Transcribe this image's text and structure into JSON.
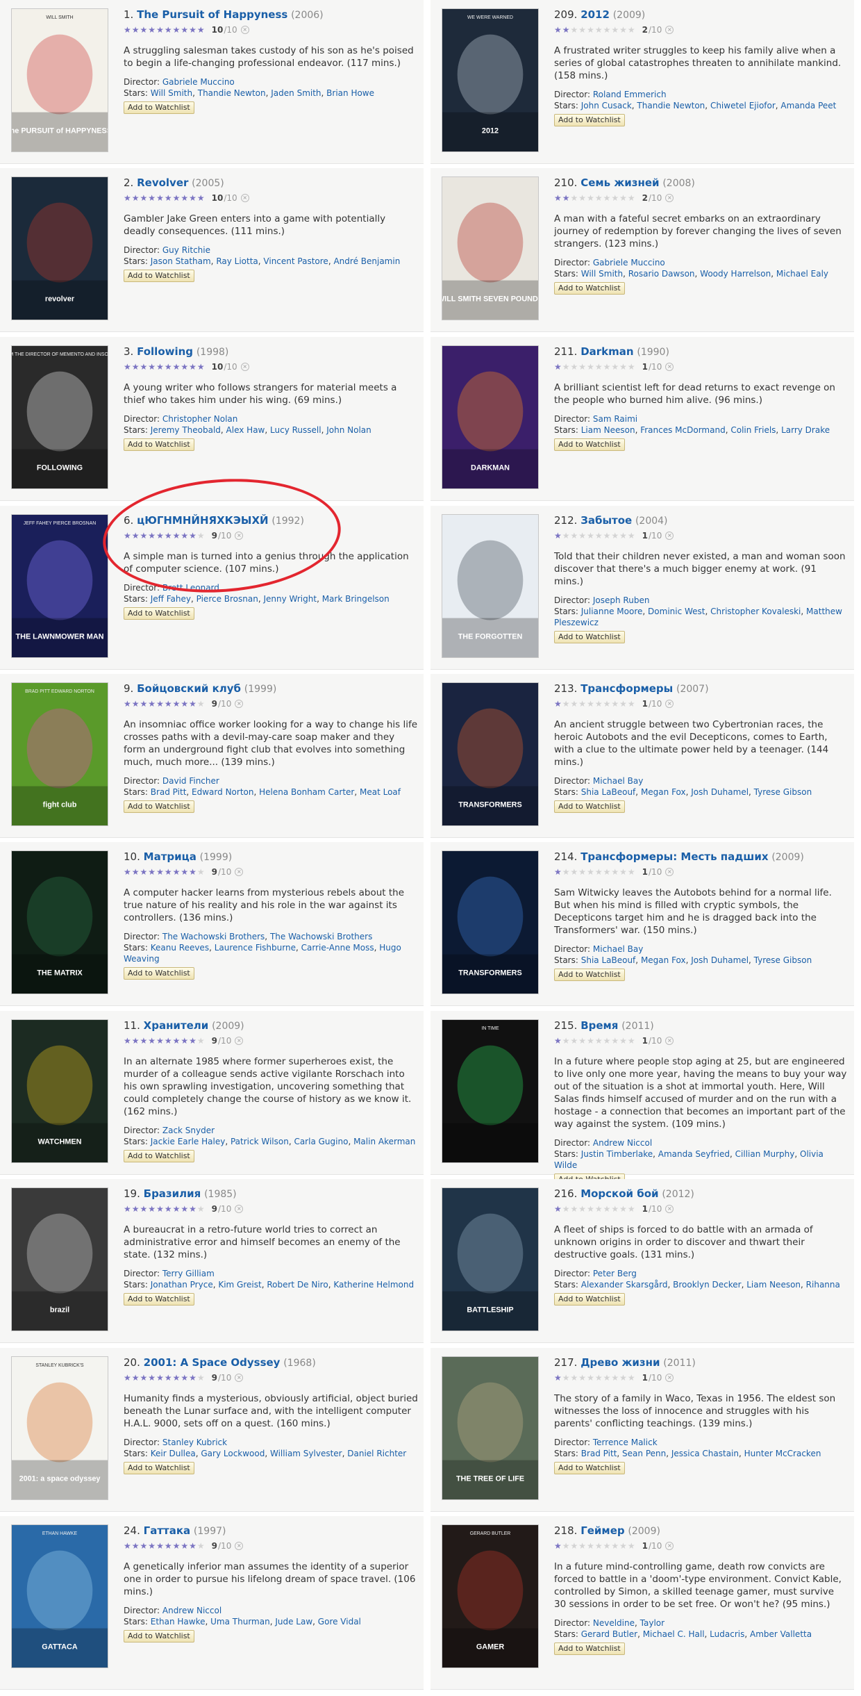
{
  "list_left": [
    {
      "rank": "1.",
      "title": "The Pursuit of Happyness",
      "year": "(2006)",
      "stars": 10,
      "score": "10",
      "outof": "/10",
      "outline": "A struggling salesman takes custody of his son as he's poised to begin a life-changing professional endeavor. (117 mins.)",
      "director": [
        "Gabriele Muccino"
      ],
      "cast": [
        "Will Smith",
        "Thandie Newton",
        "Jaden Smith",
        "Brian Howe"
      ],
      "poster": {
        "bg": "#f3f1ea",
        "accent": "#c33",
        "caption": "WILL SMITH",
        "tagline": "the PURSUIT of HAPPYNESS"
      }
    },
    {
      "rank": "2.",
      "title": "Revolver",
      "year": "(2005)",
      "stars": 10,
      "score": "10",
      "outof": "/10",
      "outline": "Gambler Jake Green enters into a game with potentially deadly consequences. (111 mins.)",
      "director": [
        "Guy Ritchie"
      ],
      "cast": [
        "Jason Statham",
        "Ray Liotta",
        "Vincent Pastore",
        "André Benjamin"
      ],
      "poster": {
        "bg": "#1b2a3a",
        "accent": "#c0392b",
        "caption": "",
        "tagline": "revolver"
      }
    },
    {
      "rank": "3.",
      "title": "Following",
      "year": "(1998)",
      "stars": 10,
      "score": "10",
      "outof": "/10",
      "outline": "A young writer who follows strangers for material meets a thief who takes him under his wing. (69 mins.)",
      "director": [
        "Christopher Nolan"
      ],
      "cast": [
        "Jeremy Theobald",
        "Alex Haw",
        "Lucy Russell",
        "John Nolan"
      ],
      "poster": {
        "bg": "#2a2a2a",
        "accent": "#eeeeee",
        "caption": "FROM THE DIRECTOR OF MEMENTO AND INSOMNIA",
        "tagline": "FOLLOWING"
      }
    },
    {
      "rank": "6.",
      "title": "цЮГНМНЙНЯХКЭЫХЙ",
      "year": "(1992)",
      "stars": 9,
      "score": "9",
      "outof": "/10",
      "outline": "A simple man is turned into a genius through the application of computer science. (107 mins.)",
      "director": [
        "Brett Leonard"
      ],
      "cast": [
        "Jeff Fahey",
        "Pierce Brosnan",
        "Jenny Wright",
        "Mark Bringelson"
      ],
      "poster": {
        "bg": "#1a1f5a",
        "accent": "#8a7cff",
        "caption": "JEFF FAHEY   PIERCE BROSNAN",
        "tagline": "THE LAWNMOWER MAN"
      }
    },
    {
      "rank": "9.",
      "title": "Бойцовский клуб",
      "year": "(1999)",
      "stars": 9,
      "score": "9",
      "outof": "/10",
      "outline": "An insomniac office worker looking for a way to change his life crosses paths with a devil-may-care soap maker and they form an underground fight club that evolves into something much, much more... (139 mins.)",
      "director": [
        "David Fincher"
      ],
      "cast": [
        "Brad Pitt",
        "Edward Norton",
        "Helena Bonham Carter",
        "Meat Loaf"
      ],
      "poster": {
        "bg": "#5a9a2a",
        "accent": "#e94bb0",
        "caption": "BRAD PITT  EDWARD NORTON",
        "tagline": "fight club"
      }
    },
    {
      "rank": "10.",
      "title": "Матрица",
      "year": "(1999)",
      "stars": 9,
      "score": "9",
      "outof": "/10",
      "outline": "A computer hacker learns from mysterious rebels about the true nature of his reality and his role in the war against its controllers. (136 mins.)",
      "director": [
        "The Wachowski Brothers",
        "The Wachowski Brothers"
      ],
      "cast": [
        "Keanu Reeves",
        "Laurence Fishburne",
        "Carrie-Anne Moss",
        "Hugo Weaving"
      ],
      "poster": {
        "bg": "#0f1c14",
        "accent": "#2f7a4a",
        "caption": "",
        "tagline": "THE MATRIX"
      }
    },
    {
      "rank": "11.",
      "title": "Хранители",
      "year": "(2009)",
      "stars": 9,
      "score": "9",
      "outof": "/10",
      "outline": "In an alternate 1985 where former superheroes exist, the murder of a colleague sends active vigilante Rorschach into his own sprawling investigation, uncovering something that could completely change the course of history as we know it. (162 mins.)",
      "director": [
        "Zack Snyder"
      ],
      "cast": [
        "Jackie Earle Haley",
        "Patrick Wilson",
        "Carla Gugino",
        "Malin Akerman"
      ],
      "poster": {
        "bg": "#1c2b22",
        "accent": "#e8c21c",
        "caption": "",
        "tagline": "WATCHMEN"
      }
    },
    {
      "rank": "19.",
      "title": "Бразилия",
      "year": "(1985)",
      "stars": 9,
      "score": "9",
      "outof": "/10",
      "outline": "A bureaucrat in a retro-future world tries to correct an administrative error and himself becomes an enemy of the state. (132 mins.)",
      "director": [
        "Terry Gilliam"
      ],
      "cast": [
        "Jonathan Pryce",
        "Kim Greist",
        "Robert De Niro",
        "Katherine Helmond"
      ],
      "poster": {
        "bg": "#3a3a3a",
        "accent": "#dddddd",
        "caption": "",
        "tagline": "brazil"
      }
    },
    {
      "rank": "20.",
      "title": "2001: A Space Odyssey",
      "year": "(1968)",
      "stars": 9,
      "score": "9",
      "outof": "/10",
      "outline": "Humanity finds a mysterious, obviously artificial, object buried beneath the Lunar surface and, with the intelligent computer H.A.L. 9000, sets off on a quest. (160 mins.)",
      "director": [
        "Stanley Kubrick"
      ],
      "cast": [
        "Keir Dullea",
        "Gary Lockwood",
        "William Sylvester",
        "Daniel Richter"
      ],
      "poster": {
        "bg": "#f4f4f0",
        "accent": "#d86a1f",
        "caption": "STANLEY KUBRICK'S",
        "tagline": "2001: a space odyssey"
      }
    },
    {
      "rank": "24.",
      "title": "Гаттака",
      "year": "(1997)",
      "stars": 9,
      "score": "9",
      "outof": "/10",
      "outline": "A genetically inferior man assumes the identity of a superior one in order to pursue his lifelong dream of space travel. (106 mins.)",
      "director": [
        "Andrew Niccol"
      ],
      "cast": [
        "Ethan Hawke",
        "Uma Thurman",
        "Jude Law",
        "Gore Vidal"
      ],
      "poster": {
        "bg": "#2a6aa8",
        "accent": "#9fd1f2",
        "caption": "ETHAN HAWKE",
        "tagline": "GATTACA"
      }
    }
  ],
  "list_right": [
    {
      "rank": "209.",
      "title": "2012",
      "year": "(2009)",
      "stars": 2,
      "score": "2",
      "outof": "/10",
      "outline": "A frustrated writer struggles to keep his family alive when a series of global catastrophes threaten to annihilate mankind. (158 mins.)",
      "director": [
        "Roland Emmerich"
      ],
      "cast": [
        "John Cusack",
        "Thandie Newton",
        "Chiwetel Ejiofor",
        "Amanda Peet"
      ],
      "poster": {
        "bg": "#1e2a3a",
        "accent": "#c9d3e0",
        "caption": "WE WERE WARNED",
        "tagline": "2012"
      }
    },
    {
      "rank": "210.",
      "title": "Семь жизней",
      "year": "(2008)",
      "stars": 2,
      "score": "2",
      "outof": "/10",
      "outline": "A man with a fateful secret embarks on an extraordinary journey of redemption by forever changing the lives of seven strangers. (123 mins.)",
      "director": [
        "Gabriele Muccino"
      ],
      "cast": [
        "Will Smith",
        "Rosario Dawson",
        "Woody Harrelson",
        "Michael Ealy"
      ],
      "poster": {
        "bg": "#e9e6df",
        "accent": "#b3261e",
        "caption": "",
        "tagline": "WILL SMITH  SEVEN POUNDS"
      }
    },
    {
      "rank": "211.",
      "title": "Darkman",
      "year": "(1990)",
      "stars": 1,
      "score": "1",
      "outof": "/10",
      "outline": "A brilliant scientist left for dead returns to exact revenge on the people who burned him alive. (96 mins.)",
      "director": [
        "Sam Raimi"
      ],
      "cast": [
        "Liam Neeson",
        "Frances McDormand",
        "Colin Friels",
        "Larry Drake"
      ],
      "poster": {
        "bg": "#3b1f6a",
        "accent": "#ff8a1c",
        "caption": "",
        "tagline": "DARKMAN"
      }
    },
    {
      "rank": "212.",
      "title": "Забытое",
      "year": "(2004)",
      "stars": 1,
      "score": "1",
      "outof": "/10",
      "outline": "Told that their children never existed, a man and woman soon discover that there's a much bigger enemy at work. (91 mins.)",
      "director": [
        "Joseph Ruben"
      ],
      "cast": [
        "Julianne Moore",
        "Dominic West",
        "Christopher Kovaleski",
        "Matthew Pleszewicz"
      ],
      "poster": {
        "bg": "#e8edf2",
        "accent": "#3a4450",
        "caption": "",
        "tagline": "THE FORGOTTEN"
      }
    },
    {
      "rank": "213.",
      "title": "Трансформеры",
      "year": "(2007)",
      "stars": 1,
      "score": "1",
      "outof": "/10",
      "outline": "An ancient struggle between two Cybertronian races, the heroic Autobots and the evil Decepticons, comes to Earth, with a clue to the ultimate power held by a teenager. (144 mins.)",
      "director": [
        "Michael Bay"
      ],
      "cast": [
        "Shia LaBeouf",
        "Megan Fox",
        "Josh Duhamel",
        "Tyrese Gibson"
      ],
      "poster": {
        "bg": "#1a2440",
        "accent": "#e0622a",
        "caption": "",
        "tagline": "TRANSFORMERS"
      }
    },
    {
      "rank": "214.",
      "title": "Трансформеры: Месть падших",
      "year": "(2009)",
      "stars": 1,
      "score": "1",
      "outof": "/10",
      "outline": "Sam Witwicky leaves the Autobots behind for a normal life. But when his mind is filled with cryptic symbols, the Decepticons target him and he is dragged back into the Transformers' war. (150 mins.)",
      "director": [
        "Michael Bay"
      ],
      "cast": [
        "Shia LaBeouf",
        "Megan Fox",
        "Josh Duhamel",
        "Tyrese Gibson"
      ],
      "poster": {
        "bg": "#0c1a33",
        "accent": "#3f7fd8",
        "caption": "",
        "tagline": "TRANSFORMERS"
      }
    },
    {
      "rank": "215.",
      "title": "Время",
      "year": "(2011)",
      "stars": 1,
      "score": "1",
      "outof": "/10",
      "outline": "In a future where people stop aging at 25, but are engineered to live only one more year, having the means to buy your way out of the situation is a shot at immortal youth. Here, Will Salas finds himself accused of murder and on the run with a hostage - a connection that becomes an important part of the way against the system. (109 mins.)",
      "director": [
        "Andrew Niccol"
      ],
      "cast": [
        "Justin Timberlake",
        "Amanda Seyfried",
        "Cillian Murphy",
        "Olivia Wilde"
      ],
      "poster": {
        "bg": "#111111",
        "accent": "#2cd15a",
        "caption": "IN TIME",
        "tagline": ""
      }
    },
    {
      "rank": "216.",
      "title": "Морской бой",
      "year": "(2012)",
      "stars": 1,
      "score": "1",
      "outof": "/10",
      "outline": "A fleet of ships is forced to do battle with an armada of unknown origins in order to discover and thwart their destructive goals. (131 mins.)",
      "director": [
        "Peter Berg"
      ],
      "cast": [
        "Alexander Skarsgård",
        "Brooklyn Decker",
        "Liam Neeson",
        "Rihanna"
      ],
      "poster": {
        "bg": "#203448",
        "accent": "#9bb4c9",
        "caption": "",
        "tagline": "BATTLESHIP"
      }
    },
    {
      "rank": "217.",
      "title": "Древо жизни",
      "year": "(2011)",
      "stars": 1,
      "score": "1",
      "outof": "/10",
      "outline": "The story of a family in Waco, Texas in 1956. The eldest son witnesses the loss of innocence and struggles with his parents' conflicting teachings. (139 mins.)",
      "director": [
        "Terrence Malick"
      ],
      "cast": [
        "Brad Pitt",
        "Sean Penn",
        "Jessica Chastain",
        "Hunter McCracken"
      ],
      "poster": {
        "bg": "#5a6b58",
        "accent": "#c7b48a",
        "caption": "",
        "tagline": "THE TREE OF LIFE"
      }
    },
    {
      "rank": "218.",
      "title": "Геймер",
      "year": "(2009)",
      "stars": 1,
      "score": "1",
      "outof": "/10",
      "outline": "In a future mind-controlling game, death row convicts are forced to battle in a 'doom'-type environment. Convict Kable, controlled by Simon, a skilled teenage gamer, must survive 30 sessions in order to be set free. Or won't he? (95 mins.)",
      "director": [
        "Neveldine",
        "Taylor"
      ],
      "cast": [
        "Gerard Butler",
        "Michael C. Hall",
        "Ludacris",
        "Amber Valletta"
      ],
      "poster": {
        "bg": "#221a18",
        "accent": "#c0392b",
        "caption": "GERARD BUTLER",
        "tagline": "GAMER"
      }
    }
  ],
  "labels": {
    "director": "Director:",
    "stars": "Stars:",
    "watchlist": "Add to Watchlist",
    "clear": "×"
  },
  "colors": {
    "link": "#1a5fa8",
    "star_on": "#7b74c2",
    "star_off": "#d3d3d3",
    "highlight_circle": "#e3262f"
  }
}
